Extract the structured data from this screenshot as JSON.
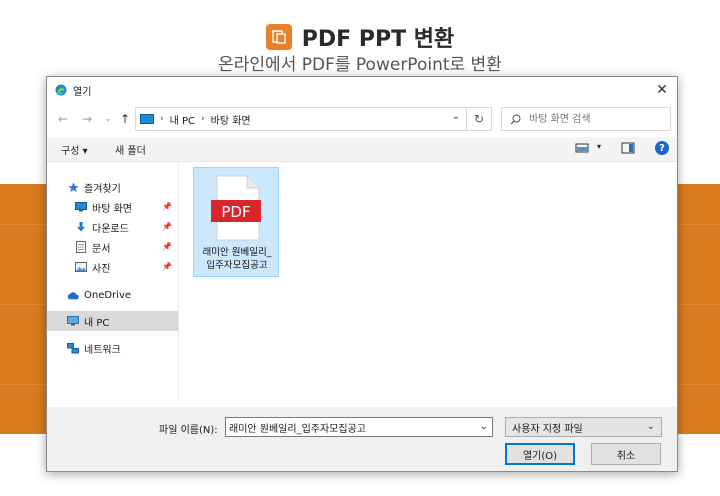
{
  "hero": {
    "title": "PDF PPT 변환",
    "subtitle": "온라인에서 PDF를 PowerPoint로 변환"
  },
  "dialog": {
    "title": "열기",
    "close_icon": "close-icon",
    "nav": {
      "back_icon": "arrow-left-icon",
      "forward_icon": "arrow-right-icon",
      "recent_icon": "chevron-down-icon",
      "up_icon": "arrow-up-icon"
    },
    "breadcrumb": [
      "내 PC",
      "바탕 화면"
    ],
    "search_placeholder": "바탕 화면 검색",
    "toolbar": {
      "organize_label": "구성",
      "new_folder_label": "새 폴더"
    },
    "sidebar": {
      "items": [
        {
          "label": "즐겨찾기",
          "icon": "star-icon"
        },
        {
          "label": "바탕 화면",
          "icon": "desktop-icon",
          "pinned": true
        },
        {
          "label": "다운로드",
          "icon": "download-icon",
          "pinned": true
        },
        {
          "label": "문서",
          "icon": "document-icon",
          "pinned": true
        },
        {
          "label": "사진",
          "icon": "picture-icon",
          "pinned": true
        },
        {
          "label": "OneDrive",
          "icon": "cloud-icon"
        },
        {
          "label": "내 PC",
          "icon": "computer-icon",
          "selected": true
        },
        {
          "label": "네트워크",
          "icon": "network-icon"
        }
      ]
    },
    "files": [
      {
        "name_line1": "래미안 원베일리_",
        "name_line2": "입주자모집공고",
        "badge": "PDF"
      }
    ],
    "bottom": {
      "filename_label": "파일 이름(N):",
      "filename_value": "래미안 원베일리_입주자모집공고",
      "filetype_value": "사용자 지정 파일",
      "open_label": "열기(O)",
      "cancel_label": "취소"
    }
  },
  "colors": {
    "accent_orange": "#d97b1f",
    "pdf_red": "#d9262d",
    "selection_blue": "#cce8ff",
    "help_blue": "#1a66c9"
  }
}
